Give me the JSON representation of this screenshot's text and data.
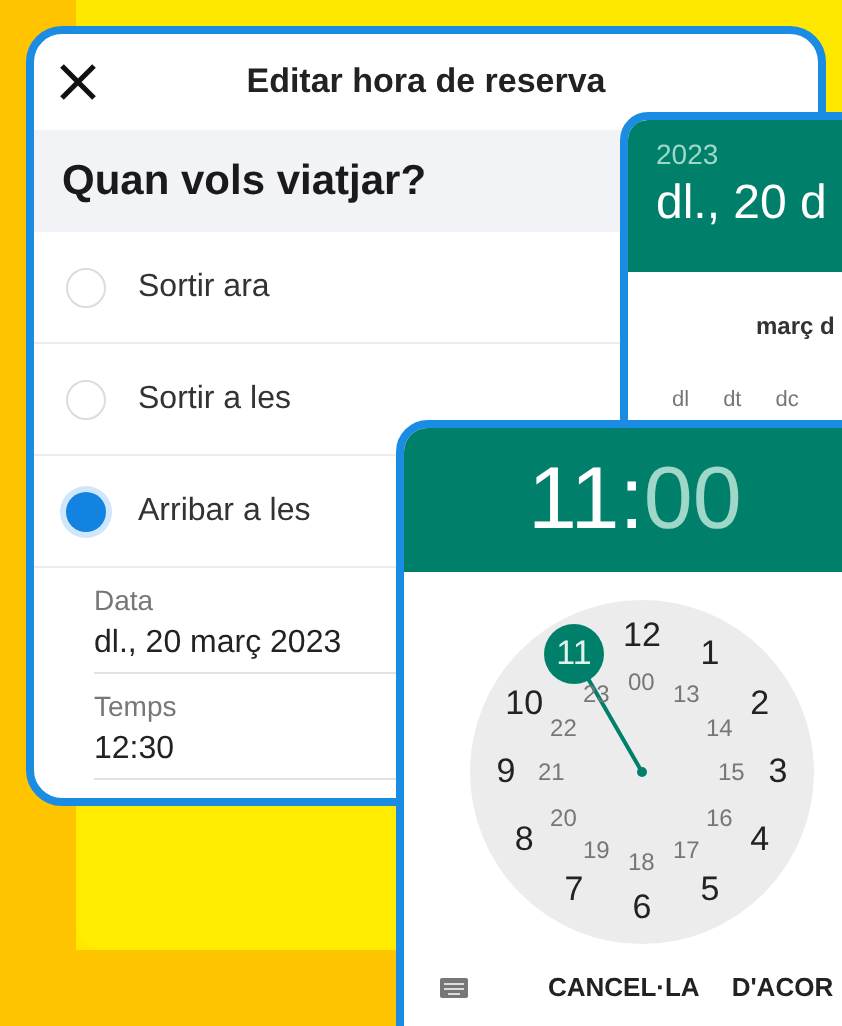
{
  "booking_dialog": {
    "title": "Editar hora de reserva",
    "question": "Quan vols viatjar?",
    "options": [
      {
        "label": "Sortir ara",
        "selected": false
      },
      {
        "label": "Sortir a les",
        "selected": false
      },
      {
        "label": "Arribar a les",
        "selected": true
      }
    ],
    "fields": [
      {
        "label": "Data",
        "value": "dl., 20 març 2023"
      },
      {
        "label": "Temps",
        "value": "12:30"
      }
    ]
  },
  "date_picker": {
    "year": "2023",
    "date": "dl., 20 d",
    "month": "març d",
    "weekdays": [
      "dl",
      "dt",
      "dc"
    ]
  },
  "time_picker": {
    "hours": "11",
    "separator": ":",
    "minutes": "00",
    "outer_ring": [
      {
        "label": "12",
        "selected": false
      },
      {
        "label": "1",
        "selected": false
      },
      {
        "label": "2",
        "selected": false
      },
      {
        "label": "3",
        "selected": false
      },
      {
        "label": "4",
        "selected": false
      },
      {
        "label": "5",
        "selected": false
      },
      {
        "label": "6",
        "selected": false
      },
      {
        "label": "7",
        "selected": false
      },
      {
        "label": "8",
        "selected": false
      },
      {
        "label": "9",
        "selected": false
      },
      {
        "label": "10",
        "selected": false
      },
      {
        "label": "11",
        "selected": true
      }
    ],
    "inner_ring": [
      "00",
      "13",
      "14",
      "15",
      "16",
      "17",
      "18",
      "19",
      "20",
      "21",
      "22",
      "23"
    ],
    "buttons": [
      "CANCEL·LA",
      "D'ACOR"
    ]
  }
}
